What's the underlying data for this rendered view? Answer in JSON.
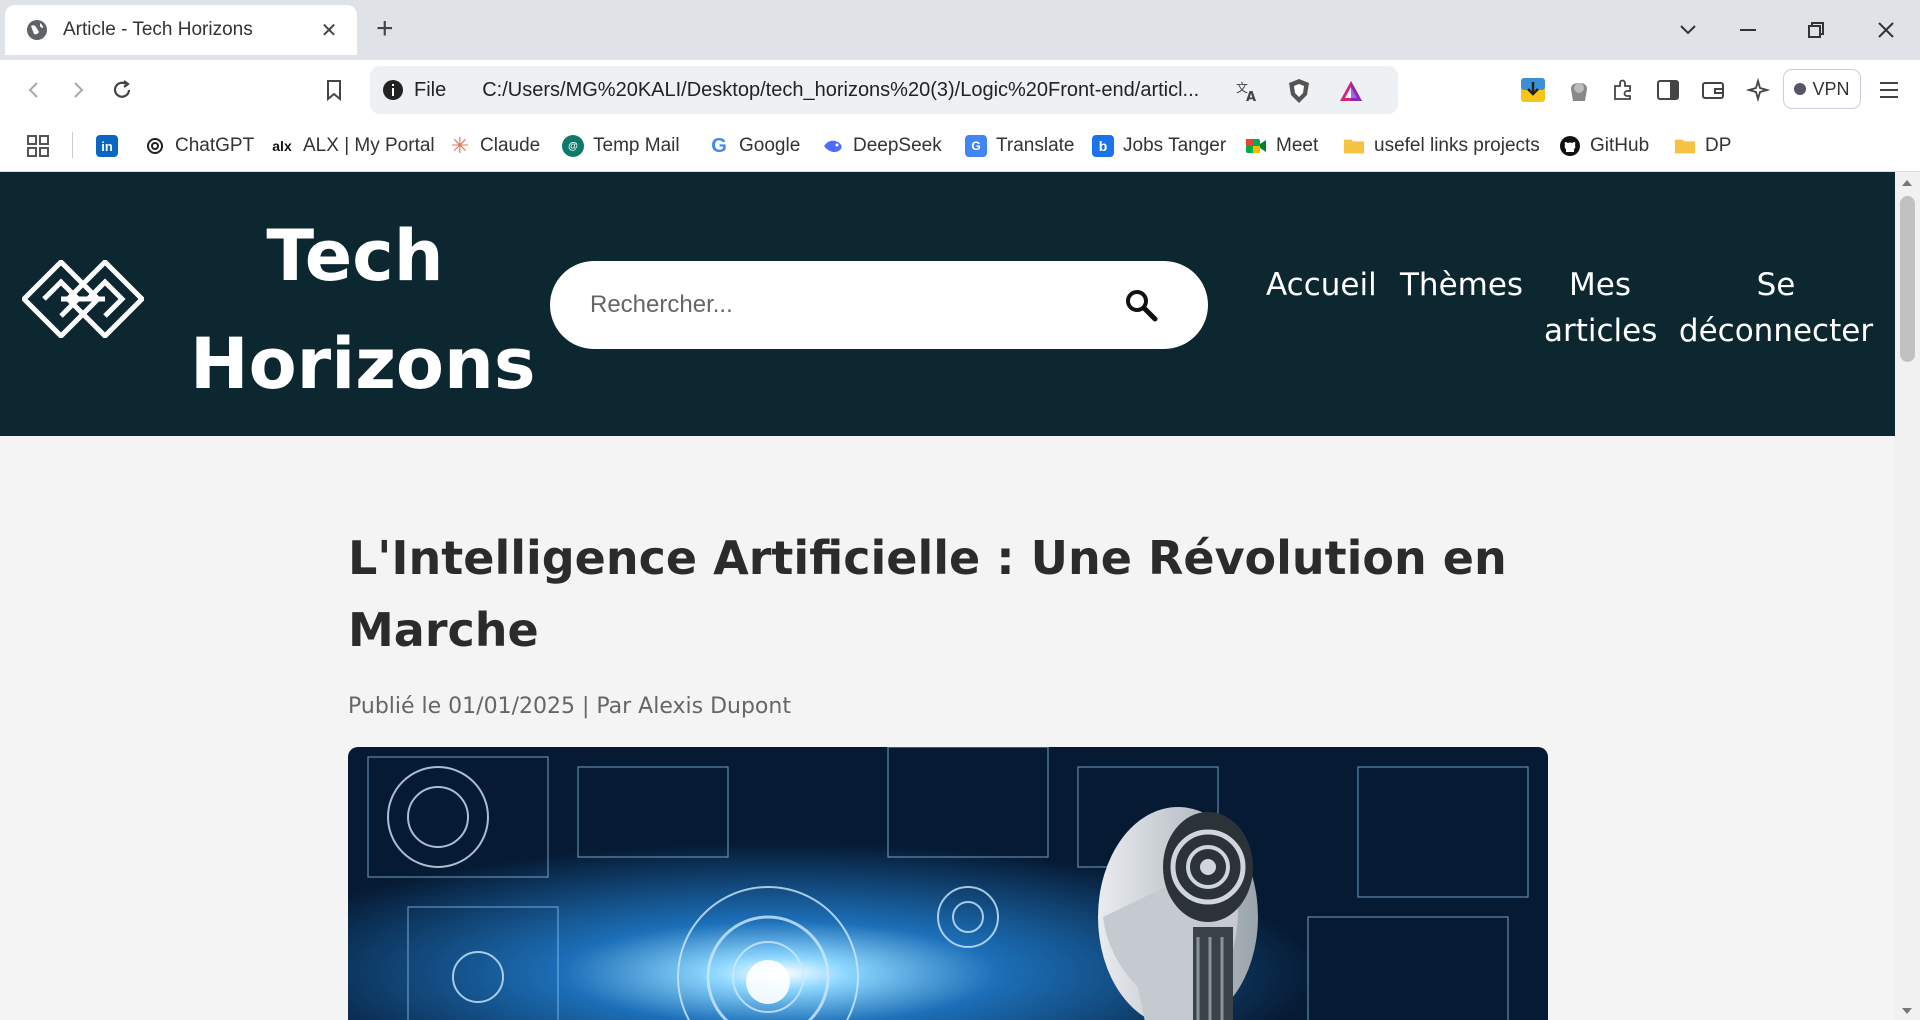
{
  "browser": {
    "tab_title": "Article - Tech Horizons",
    "tab_close": "✕",
    "new_tab": "+",
    "url_scheme": "File",
    "url": "C:/Users/MG%20KALI/Desktop/tech_horizons%20(3)/Logic%20Front-end/articl...",
    "vpn_label": "VPN",
    "bookmarks": [
      {
        "label": "ChatGPT",
        "icon": "chatgpt-icon"
      },
      {
        "label": "ALX | My Portal",
        "icon": "alx-icon"
      },
      {
        "label": "Claude",
        "icon": "claude-icon"
      },
      {
        "label": "Temp Mail",
        "icon": "tempmail-icon"
      },
      {
        "label": "Google",
        "icon": "google-icon"
      },
      {
        "label": "DeepSeek",
        "icon": "deepseek-icon"
      },
      {
        "label": "Translate",
        "icon": "translate-icon"
      },
      {
        "label": "Jobs Tanger",
        "icon": "jobs-icon"
      },
      {
        "label": "Meet",
        "icon": "meet-icon"
      },
      {
        "label": "usefel links projects",
        "icon": "folder-icon"
      },
      {
        "label": "GitHub",
        "icon": "github-icon"
      },
      {
        "label": "DP",
        "icon": "folder-icon"
      }
    ]
  },
  "site": {
    "title_line1": "Tech",
    "title_line2": "Horizons",
    "search_placeholder": "Rechercher...",
    "nav": {
      "home": "Accueil",
      "themes": "Thèmes",
      "my_articles_1": "Mes",
      "my_articles_2": "articles",
      "logout_1": "Se",
      "logout_2": "déconnecter"
    },
    "header_color": "#0d2731"
  },
  "article": {
    "title_line1": "L'Intelligence Artificielle : Une Révolution en",
    "title_line2": "Marche",
    "meta": "Publié le 01/01/2025 | Par Alexis Dupont"
  }
}
